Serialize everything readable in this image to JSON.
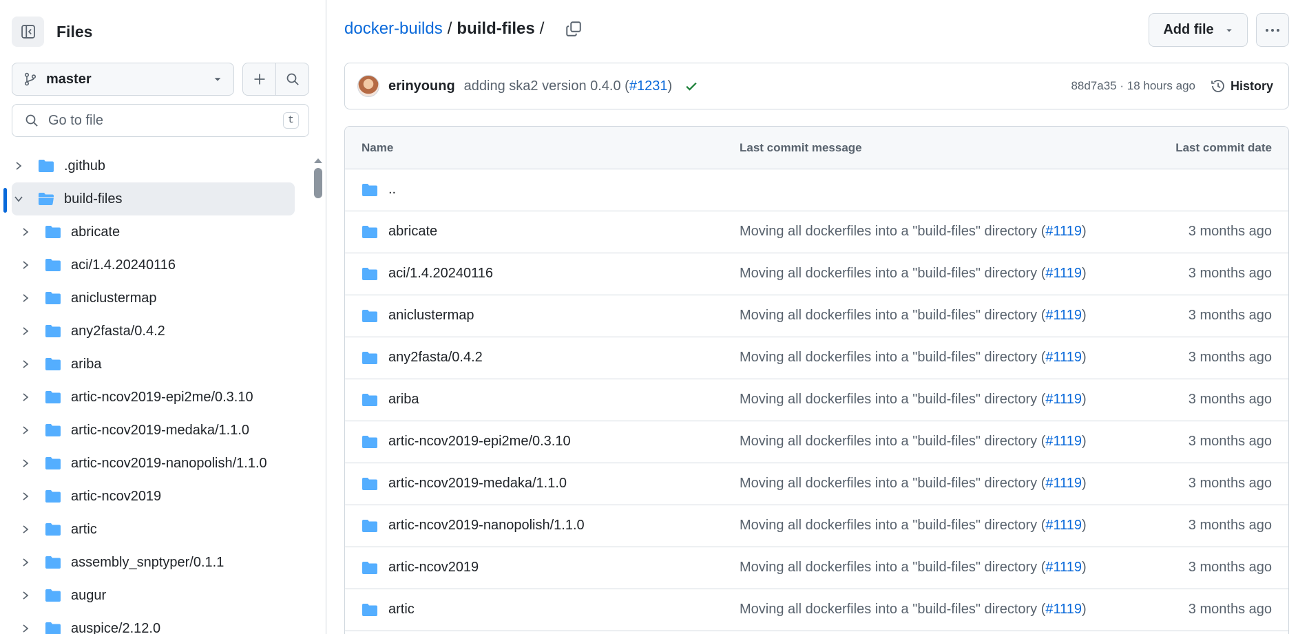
{
  "sidebar": {
    "title": "Files",
    "branch": "master",
    "search_placeholder": "Go to file",
    "search_shortcut": "t",
    "tree": [
      {
        "label": ".github",
        "level": 0,
        "expanded": false
      },
      {
        "label": "build-files",
        "level": 0,
        "expanded": true,
        "active": true
      },
      {
        "label": "abricate",
        "level": 1
      },
      {
        "label": "aci/1.4.20240116",
        "level": 1
      },
      {
        "label": "aniclustermap",
        "level": 1
      },
      {
        "label": "any2fasta/0.4.2",
        "level": 1
      },
      {
        "label": "ariba",
        "level": 1
      },
      {
        "label": "artic-ncov2019-epi2me/0.3.10",
        "level": 1
      },
      {
        "label": "artic-ncov2019-medaka/1.1.0",
        "level": 1
      },
      {
        "label": "artic-ncov2019-nanopolish/1.1.0",
        "level": 1
      },
      {
        "label": "artic-ncov2019",
        "level": 1
      },
      {
        "label": "artic",
        "level": 1
      },
      {
        "label": "assembly_snptyper/0.1.1",
        "level": 1
      },
      {
        "label": "augur",
        "level": 1
      },
      {
        "label": "auspice/2.12.0",
        "level": 1
      }
    ]
  },
  "breadcrumb": {
    "repo": "docker-builds",
    "separator": "/",
    "current": "build-files",
    "trailing": "/"
  },
  "toolbar": {
    "add_file_label": "Add file"
  },
  "commit": {
    "author": "erinyoung",
    "message": "adding ska2 version 0.4.0 (",
    "pr": "#1231",
    "message_end": ")",
    "sha": "88d7a35",
    "sha_sep": " · ",
    "time": "18 hours ago",
    "history_label": "History"
  },
  "table": {
    "headers": {
      "name": "Name",
      "message": "Last commit message",
      "date": "Last commit date"
    },
    "parent_row": "..",
    "rows": [
      {
        "name": "abricate",
        "msg": "Moving all dockerfiles into a \"build-files\" directory (",
        "pr": "#1119",
        "msg_end": ")",
        "date": "3 months ago"
      },
      {
        "name": "aci/1.4.20240116",
        "msg": "Moving all dockerfiles into a \"build-files\" directory (",
        "pr": "#1119",
        "msg_end": ")",
        "date": "3 months ago"
      },
      {
        "name": "aniclustermap",
        "msg": "Moving all dockerfiles into a \"build-files\" directory (",
        "pr": "#1119",
        "msg_end": ")",
        "date": "3 months ago"
      },
      {
        "name": "any2fasta/0.4.2",
        "msg": "Moving all dockerfiles into a \"build-files\" directory (",
        "pr": "#1119",
        "msg_end": ")",
        "date": "3 months ago"
      },
      {
        "name": "ariba",
        "msg": "Moving all dockerfiles into a \"build-files\" directory (",
        "pr": "#1119",
        "msg_end": ")",
        "date": "3 months ago"
      },
      {
        "name": "artic-ncov2019-epi2me/0.3.10",
        "msg": "Moving all dockerfiles into a \"build-files\" directory (",
        "pr": "#1119",
        "msg_end": ")",
        "date": "3 months ago"
      },
      {
        "name": "artic-ncov2019-medaka/1.1.0",
        "msg": "Moving all dockerfiles into a \"build-files\" directory (",
        "pr": "#1119",
        "msg_end": ")",
        "date": "3 months ago"
      },
      {
        "name": "artic-ncov2019-nanopolish/1.1.0",
        "msg": "Moving all dockerfiles into a \"build-files\" directory (",
        "pr": "#1119",
        "msg_end": ")",
        "date": "3 months ago"
      },
      {
        "name": "artic-ncov2019",
        "msg": "Moving all dockerfiles into a \"build-files\" directory (",
        "pr": "#1119",
        "msg_end": ")",
        "date": "3 months ago"
      },
      {
        "name": "artic",
        "msg": "Moving all dockerfiles into a \"build-files\" directory (",
        "pr": "#1119",
        "msg_end": ")",
        "date": "3 months ago"
      }
    ]
  },
  "colors": {
    "accent": "#0969da",
    "folder": "#54aeff",
    "success": "#1a7f37",
    "border": "#d0d7de"
  }
}
